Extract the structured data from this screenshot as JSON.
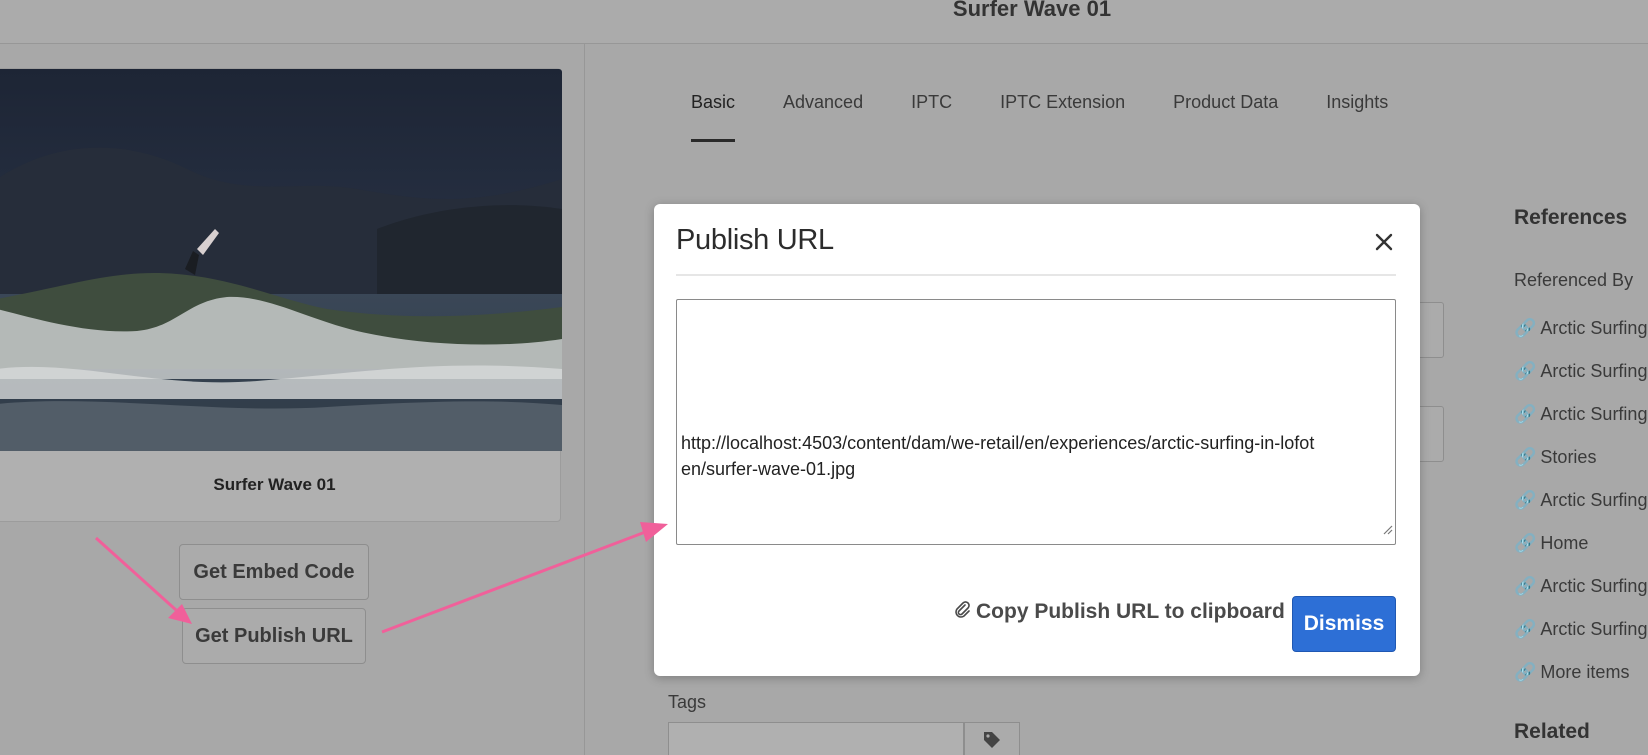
{
  "header": {
    "title": "Surfer Wave 01"
  },
  "asset": {
    "card_title": "Surfer Wave 01",
    "embed_button": "Get Embed Code",
    "publish_button": "Get Publish URL"
  },
  "tabs": [
    {
      "label": "Basic",
      "active": true
    },
    {
      "label": "Advanced"
    },
    {
      "label": "IPTC"
    },
    {
      "label": "IPTC Extension"
    },
    {
      "label": "Product Data"
    },
    {
      "label": "Insights"
    }
  ],
  "tags": {
    "label": "Tags",
    "icon": "tag-icon"
  },
  "references": {
    "heading": "References",
    "subheading": "Referenced By",
    "items": [
      "Arctic Surfing",
      "Arctic Surfing",
      "Arctic Surfing",
      "Stories",
      "Arctic Surfing",
      "Home",
      "Arctic Surfing",
      "Arctic Surfing",
      "More items"
    ],
    "related_heading": "Related"
  },
  "modal": {
    "title": "Publish URL",
    "url": "http://localhost:4503/content/dam/we-retail/en/experiences/arctic-surfing-in-lofoten/surfer-wave-01.jpg",
    "copy_label": "Copy Publish URL to clipboard",
    "dismiss_label": "Dismiss"
  },
  "colors": {
    "overlay": "#a8a8a8",
    "accent": "#2d6fd6",
    "annotation_arrow": "#f0609a"
  }
}
